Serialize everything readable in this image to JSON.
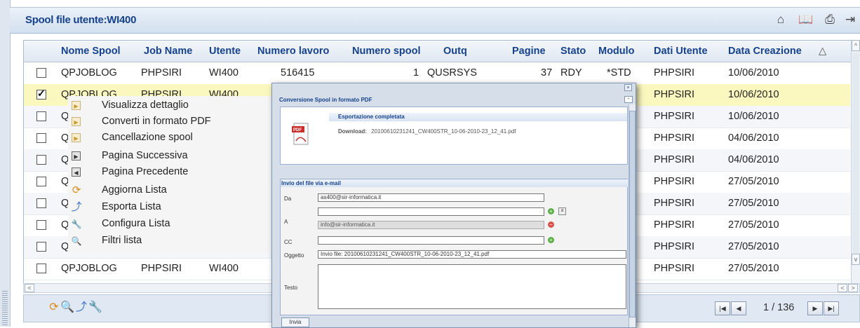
{
  "header": {
    "title": "Spool file utente:WI400",
    "tools": [
      "home-icon",
      "book-icon",
      "print-icon",
      "exit-icon"
    ]
  },
  "columns": [
    "Nome Spool",
    "Job Name",
    "Utente",
    "Numero lavoro",
    "Numero spool",
    "Outq",
    "Pagine",
    "Stato",
    "Modulo",
    "Dati Utente",
    "Data Creazione"
  ],
  "sort_indicator": "△",
  "rows": [
    {
      "nome": "QPJOBLOG",
      "job": "PHPSIRI",
      "utente": "WI400",
      "numlav": "516415",
      "numspool": "1",
      "outq": "QUSRSYS",
      "pagine": "37",
      "stato": "RDY",
      "modulo": "*STD",
      "dati": "PHPSIRI",
      "data": "10/06/2010",
      "checked": false
    },
    {
      "nome": "QPJOBLOG",
      "job": "PHPSIRI",
      "utente": "WI400",
      "dati": "PHPSIRI",
      "data": "10/06/2010",
      "checked": true
    },
    {
      "nome": "Q",
      "dati": "PHPSIRI",
      "data": "10/06/2010",
      "checked": false
    },
    {
      "nome": "Q",
      "dati": "PHPSIRI",
      "data": "04/06/2010",
      "checked": false
    },
    {
      "nome": "Q",
      "dati": "PHPSIRI",
      "data": "04/06/2010",
      "checked": false
    },
    {
      "nome": "Q",
      "dati": "PHPSIRI",
      "data": "27/05/2010",
      "checked": false
    },
    {
      "nome": "Q",
      "dati": "PHPSIRI",
      "data": "27/05/2010",
      "checked": false
    },
    {
      "nome": "Q",
      "dati": "PHPSIRI",
      "data": "27/05/2010",
      "checked": false
    },
    {
      "nome": "Q",
      "dati": "PHPSIRI",
      "data": "27/05/2010",
      "checked": false
    },
    {
      "nome": "QPJOBLOG",
      "job": "PHPSIRI",
      "utente": "WI400",
      "dati": "PHPSIRI",
      "data": "27/05/2010",
      "checked": false
    }
  ],
  "context_menu": [
    {
      "label": "Visualizza dettaglio",
      "icon": "arrow-right-icon"
    },
    {
      "label": "Converti in formato PDF",
      "icon": "arrow-right-icon"
    },
    {
      "label": "Cancellazione spool",
      "icon": "arrow-right-icon"
    },
    {
      "label": "Pagina Successiva",
      "icon": "next-page-icon"
    },
    {
      "label": "Pagina Precedente",
      "icon": "prev-page-icon"
    },
    {
      "label": "Aggiorna Lista",
      "icon": "refresh-icon"
    },
    {
      "label": "Esporta Lista",
      "icon": "export-icon"
    },
    {
      "label": "Configura Lista",
      "icon": "wrench-icon"
    },
    {
      "label": "Filtri lista",
      "icon": "search-icon"
    }
  ],
  "dialog": {
    "title": "Conversione Spool in formato PDF",
    "close": "×",
    "export_header": "Esportazione completata",
    "download_label": "Download:",
    "download_file": "20100610231241_CW400STR_10-06-2010-23_12_41.pdf",
    "email_header": "Invio del file via e-mail",
    "da_label": "Da",
    "da_value": "as400@sir-informatica.it",
    "a_label": "A",
    "a_value": "",
    "a_list_value": "info@sir-informatica.it",
    "cc_label": "CC",
    "cc_value": "",
    "oggetto_label": "Oggetto",
    "oggetto_value": "Invio file: 20100610231241_CW400STR_10-06-2010-23_12_41.pdf",
    "testo_label": "Testo",
    "testo_value": "",
    "send_button": "Invia"
  },
  "pager": {
    "text": "1 / 136"
  }
}
